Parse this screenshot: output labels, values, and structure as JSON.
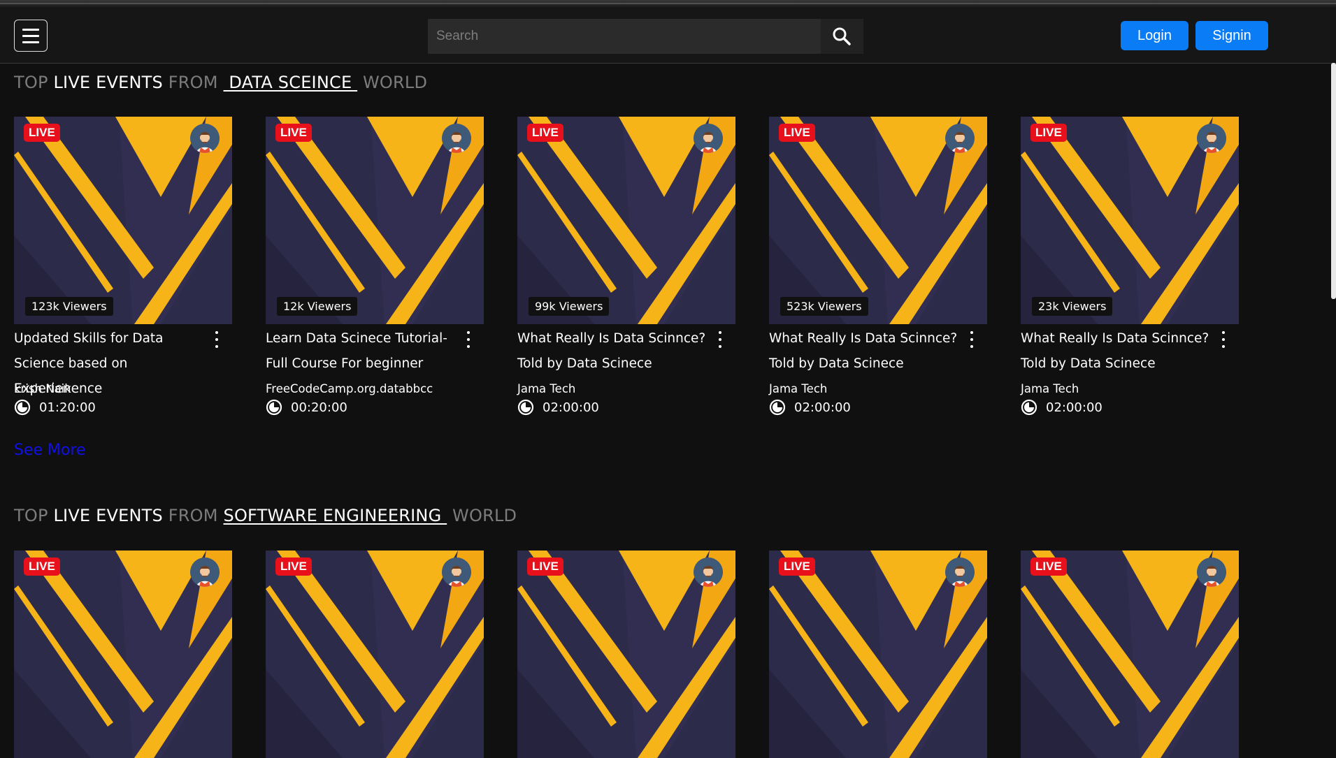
{
  "navbar": {
    "search_placeholder": "Search",
    "login_label": "Login",
    "signin_label": "Signin",
    "accent_color": "#0a7cf5"
  },
  "sections": [
    {
      "prefix": "TOP",
      "highlight": "LIVE EVENTS",
      "middle": "FROM",
      "topic": " DATA SCEINCE ",
      "suffix": "WORLD",
      "see_more": "See More",
      "cards": [
        {
          "badge": "LIVE",
          "viewers": "123k Viewers",
          "title": "Updated Skills for Data Science based on Experienence",
          "channel": "krish Naik",
          "duration": "01:20:00"
        },
        {
          "badge": "LIVE",
          "viewers": "12k Viewers",
          "title": "Learn Data Scinece Tutorial- Full Course For beginner",
          "channel": "FreeCodeCamp.org.databbcc",
          "duration": "00:20:00"
        },
        {
          "badge": "LIVE",
          "viewers": "99k Viewers",
          "title": "What Really Is Data Scinnce? Told by Data Scinece",
          "channel": "Jama Tech",
          "duration": "02:00:00"
        },
        {
          "badge": "LIVE",
          "viewers": "523k Viewers",
          "title": "What Really Is Data Scinnce? Told by Data Scinece",
          "channel": "Jama Tech",
          "duration": "02:00:00"
        },
        {
          "badge": "LIVE",
          "viewers": "23k Viewers",
          "title": "What Really Is Data Scinnce? Told by Data Scinece",
          "channel": "Jama Tech",
          "duration": "02:00:00"
        }
      ]
    },
    {
      "prefix": "TOP",
      "highlight": "LIVE EVENTS",
      "middle": "FROM",
      "topic": "SOFTWARE ENGINEERING ",
      "suffix": "WORLD",
      "cards": [
        {
          "badge": "LIVE"
        },
        {
          "badge": "LIVE"
        },
        {
          "badge": "LIVE"
        },
        {
          "badge": "LIVE"
        },
        {
          "badge": "LIVE"
        }
      ]
    }
  ],
  "colors": {
    "live_badge": "#e8111b",
    "thumb_yellow": "#f7b418",
    "thumb_navy": "#2d2b4a",
    "see_more": "#1010e8"
  },
  "icons": [
    "menu-icon",
    "search-icon",
    "avatar-icon",
    "more-vertical-icon",
    "clock-icon"
  ]
}
